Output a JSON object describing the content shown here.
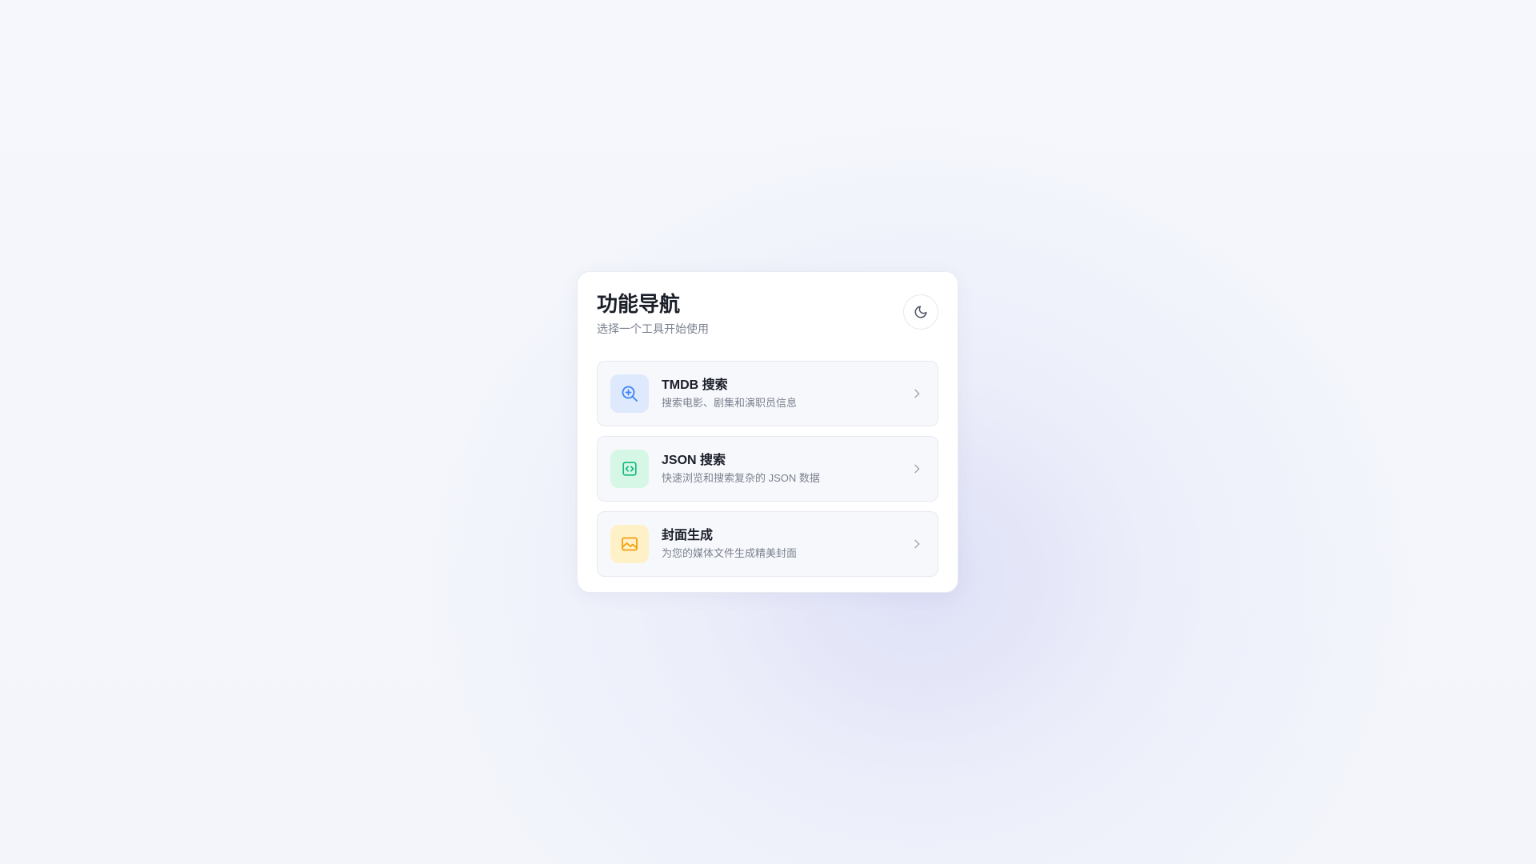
{
  "header": {
    "title": "功能导航",
    "subtitle": "选择一个工具开始使用",
    "theme_toggle_icon": "moon-icon"
  },
  "items": [
    {
      "title": "TMDB 搜索",
      "description": "搜索电影、剧集和演职员信息",
      "icon": "zoom-in-icon",
      "icon_bg": "#dfe9fd",
      "icon_color": "#3b82f6"
    },
    {
      "title": "JSON 搜索",
      "description": "快速浏览和搜索复杂的 JSON 数据",
      "icon": "code-icon",
      "icon_bg": "#d7f7e6",
      "icon_color": "#10b981"
    },
    {
      "title": "封面生成",
      "description": "为您的媒体文件生成精美封面",
      "icon": "image-icon",
      "icon_bg": "#fef1c7",
      "icon_color": "#f59e0b"
    }
  ],
  "chevron_icon": "chevron-right-icon"
}
